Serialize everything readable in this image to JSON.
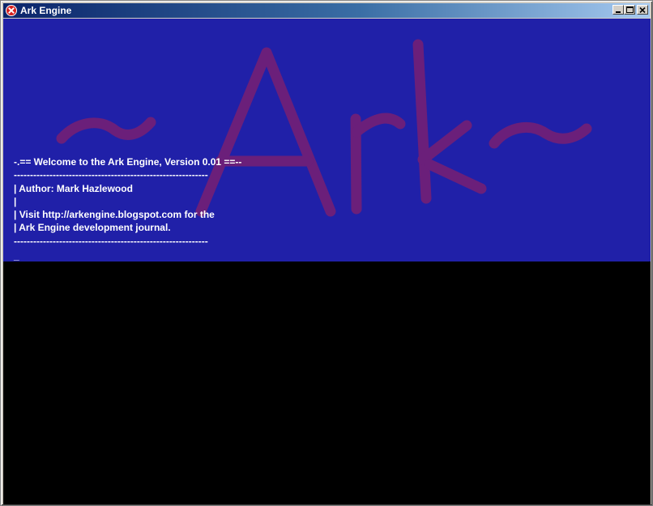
{
  "window": {
    "title": "Ark Engine",
    "controls": {
      "minimize_icon": "minimize-icon",
      "maximize_icon": "maximize-icon",
      "close_icon": "close-icon"
    },
    "app_icon": "red-x-icon"
  },
  "console": {
    "logo_text": "~Ark~",
    "logo_color": "#6b1f7a",
    "background_color": "#2020a8",
    "lower_background_color": "#000000",
    "lines": [
      "-.== Welcome to the Ark Engine, Version 0.01 ==--",
      "------------------------------------------------------------",
      "| Author: Mark Hazlewood",
      "|",
      "| Visit http://arkengine.blogspot.com for the",
      "| Ark Engine development journal.",
      "------------------------------------------------------------"
    ],
    "prompt": "_"
  }
}
